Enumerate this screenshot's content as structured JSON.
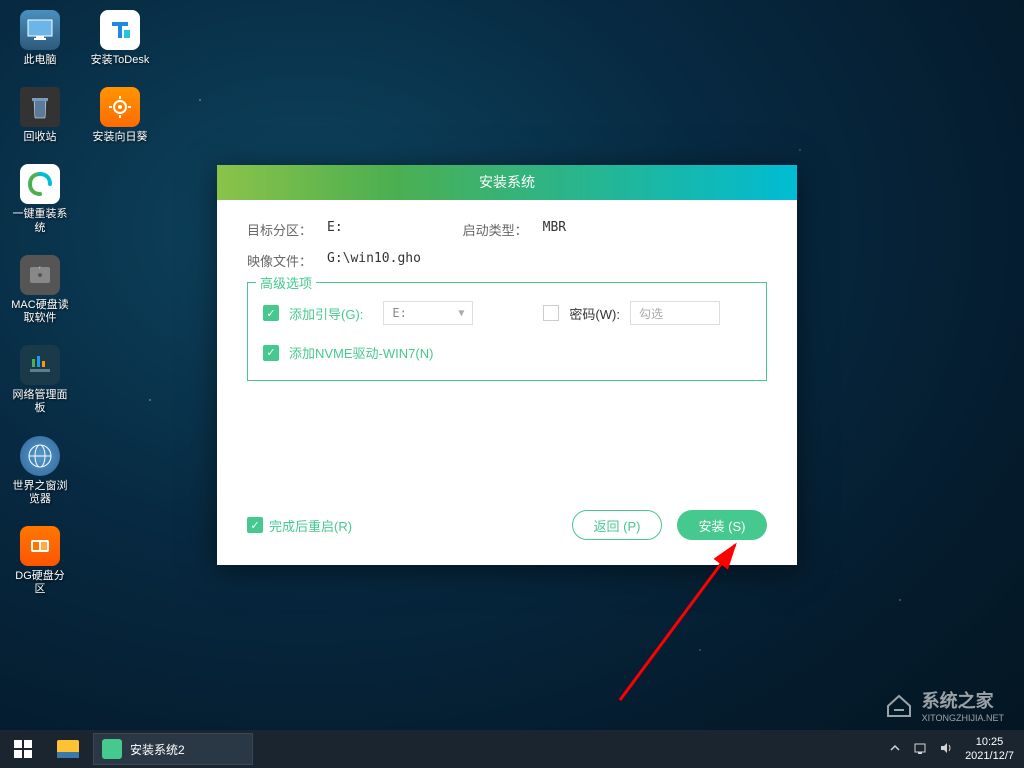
{
  "desktop": {
    "icons": [
      {
        "label": "此电脑"
      },
      {
        "label": "安装ToDesk"
      },
      {
        "label": "回收站"
      },
      {
        "label": "安装向日葵"
      },
      {
        "label": "一键重装系统"
      },
      {
        "label": "MAC硬盘读取软件"
      },
      {
        "label": "网络管理面板"
      },
      {
        "label": "世界之窗浏览器"
      },
      {
        "label": "DG硬盘分区"
      }
    ]
  },
  "dialog": {
    "title": "安装系统",
    "target_partition_label": "目标分区：",
    "target_partition_value": "E:",
    "boot_type_label": "启动类型：",
    "boot_type_value": "MBR",
    "image_file_label": "映像文件：",
    "image_file_value": "G:\\win10.gho",
    "advanced_title": "高级选项",
    "add_boot_label": "添加引导(G):",
    "add_boot_value": "E:",
    "password_label": "密码(W):",
    "password_placeholder": "勾选",
    "nvme_label": "添加NVME驱动-WIN7(N)",
    "restart_label": "完成后重启(R)",
    "back_button": "返回 (P)",
    "install_button": "安装 (S)"
  },
  "taskbar": {
    "app_title": "安装系统2",
    "time": "10:25",
    "date": "2021/12/7"
  },
  "watermark": {
    "text": "系统之家",
    "sub": "XITONGZHIJIA.NET"
  }
}
